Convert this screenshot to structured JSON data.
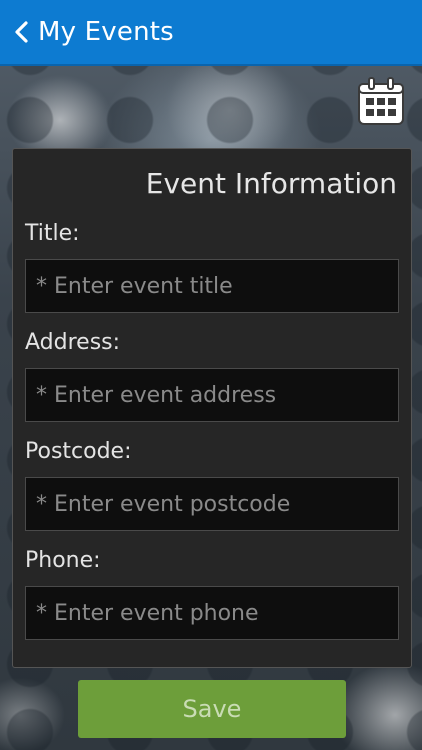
{
  "action_bar": {
    "title": "My Events",
    "back_icon": "chevron-left-icon",
    "color": "#0d7bd1"
  },
  "toolbar": {
    "calendar_icon": "calendar-icon"
  },
  "form": {
    "heading": "Event Information",
    "fields": [
      {
        "label": "Title:",
        "placeholder": "* Enter event title",
        "value": ""
      },
      {
        "label": "Address:",
        "placeholder": "* Enter event address",
        "value": ""
      },
      {
        "label": "Postcode:",
        "placeholder": "* Enter event postcode",
        "value": ""
      },
      {
        "label": "Phone:",
        "placeholder": "* Enter event phone",
        "value": ""
      }
    ],
    "save_label": "Save",
    "save_color": "#6d9e3a"
  }
}
